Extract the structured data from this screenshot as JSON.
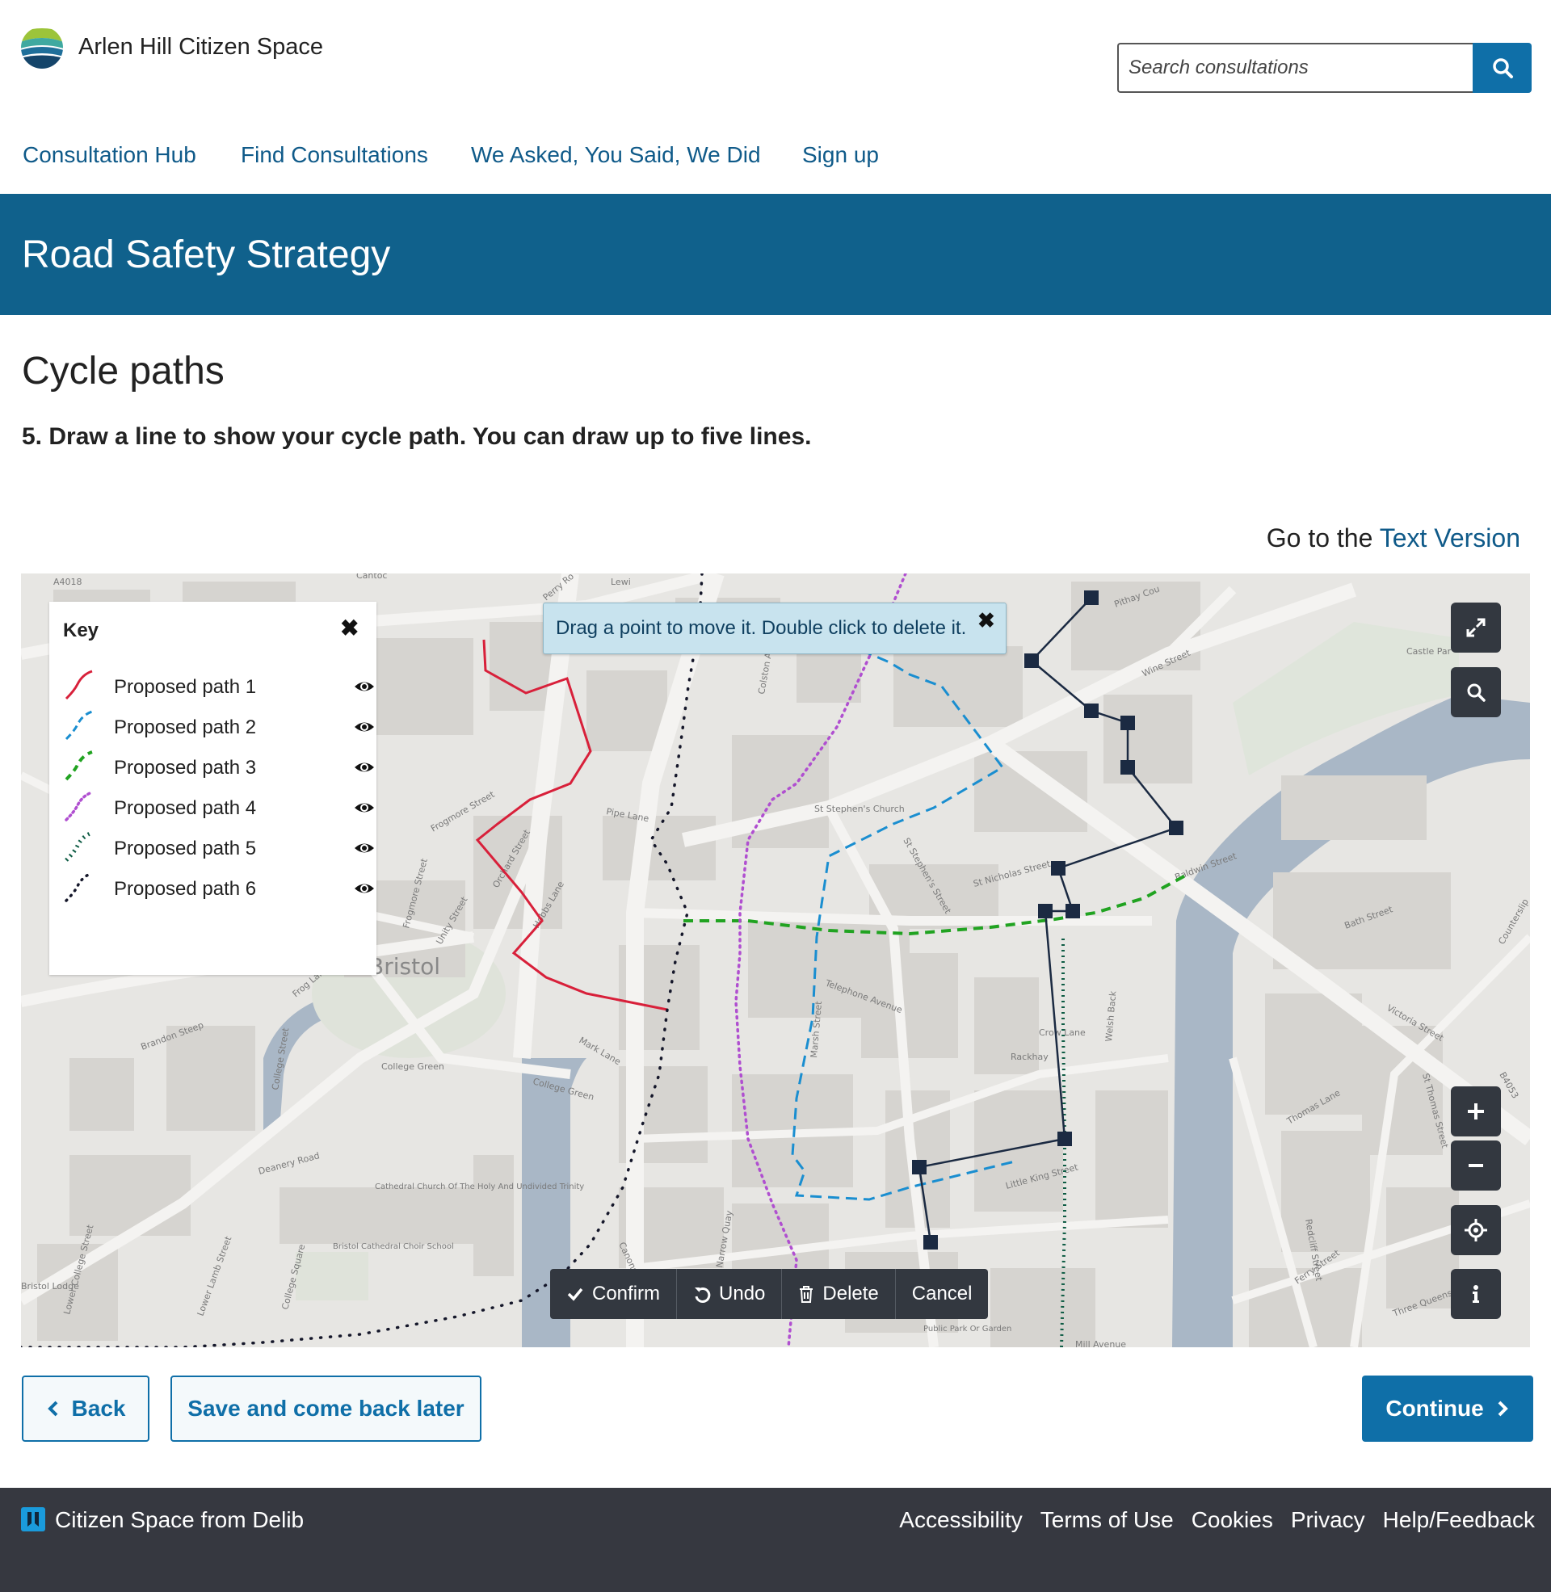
{
  "header": {
    "site_name": "Arlen Hill Citizen Space",
    "search_placeholder": "Search consultations"
  },
  "nav": [
    "Consultation Hub",
    "Find Consultations",
    "We Asked, You Said, We Did",
    "Sign up"
  ],
  "banner": {
    "title": "Road Safety Strategy"
  },
  "page": {
    "section_title": "Cycle paths",
    "question": "5. Draw a line to show your cycle path. You can draw up to five lines.",
    "text_version_prefix": "Go to the",
    "text_version_link": "Text Version"
  },
  "map": {
    "key": {
      "title": "Key",
      "items": [
        {
          "label": "Proposed path 1",
          "color": "#d8203a",
          "style": "solid"
        },
        {
          "label": "Proposed path 2",
          "color": "#1a8ed0",
          "style": "dashed"
        },
        {
          "label": "Proposed path 3",
          "color": "#21a321",
          "style": "dashed-thick"
        },
        {
          "label": "Proposed path 4",
          "color": "#b04fd0",
          "style": "dotted"
        },
        {
          "label": "Proposed path 5",
          "color": "#0e5c44",
          "style": "ticks"
        },
        {
          "label": "Proposed path 6",
          "color": "#15172a",
          "style": "dots"
        }
      ]
    },
    "tooltip": "Drag a point to move it. Double click to delete it.",
    "city_label": "Bristol",
    "street_labels": [
      "A4018",
      "Cantoc",
      "Perry Ro",
      "Lewi",
      "Pithay Cou",
      "Castle Par",
      "Wine Street",
      "Pipe Lane",
      "Colston Avenue",
      "St Stephen's Church",
      "Frogmore Street",
      "Orchard Street",
      "Unity Street",
      "Frogmore Street",
      "Hobbs Lane",
      "Frog Lane",
      "St Nicholas Street",
      "Baldwin Street",
      "Bath Street",
      "Telephone Avenue",
      "Marsh Street",
      "Crow Lane",
      "Welsh Back",
      "Rackhay",
      "Victoria Street",
      "Brandon Steep",
      "College Street",
      "Mark Lane",
      "College Green",
      "College Green",
      "Deanery Road",
      "Cathedral Church Of The Holy And Undivided Trinity",
      "Bristol Cathedral Choir School",
      "Little King Street",
      "Thomas Lane",
      "Redcliff Street",
      "St Thomas Street",
      "Ferry Street",
      "Three Queens Lane",
      "Narrow Quay",
      "Canons Road",
      "Public Park Or Garden",
      "Mill Avenue",
      "Lower Lamb Street",
      "College Square",
      "Lower College Street",
      "Bristol Lodge",
      "B4053",
      "St Stephen's Street",
      "Counterslip"
    ],
    "toolbar": {
      "confirm": "Confirm",
      "undo": "Undo",
      "delete": "Delete",
      "cancel": "Cancel"
    },
    "controls": [
      "expand-icon",
      "search-icon",
      "zoom-in-icon",
      "zoom-out-icon",
      "locate-icon",
      "info-icon"
    ]
  },
  "buttons": {
    "back": "Back",
    "save": "Save and come back later",
    "continue": "Continue"
  },
  "footer": {
    "brand": "Citizen Space from Delib",
    "links": [
      "Accessibility",
      "Terms of Use",
      "Cookies",
      "Privacy",
      "Help/Feedback"
    ]
  },
  "colors": {
    "brand_blue": "#10618c",
    "link": "#0f5a89",
    "button": "#0f6fa8",
    "footer": "#363840"
  }
}
